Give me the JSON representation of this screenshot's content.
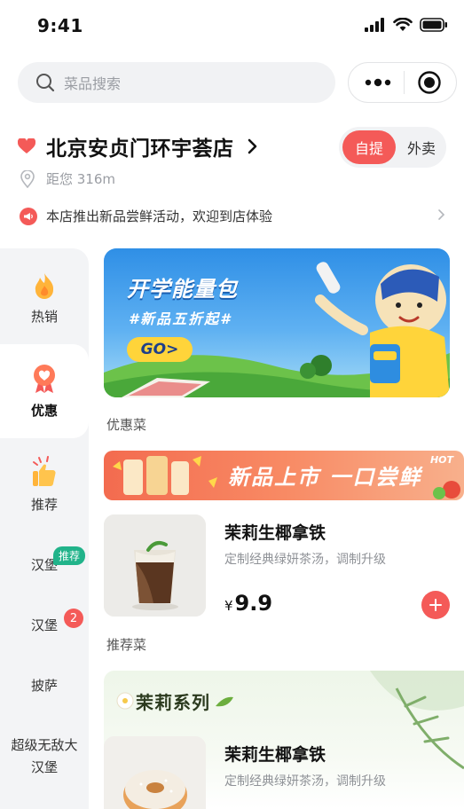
{
  "status": {
    "time": "9:41"
  },
  "search": {
    "placeholder": "菜品搜索"
  },
  "store": {
    "name": "北京安贞门环宇荟店",
    "distance": "距您 316m",
    "mode_pickup": "自提",
    "mode_delivery": "外卖",
    "notice": "本店推出新品尝鲜活动，欢迎到店体验"
  },
  "sidebar": {
    "items": [
      {
        "label": "热销",
        "icon": "fire-icon"
      },
      {
        "label": "优惠",
        "icon": "discount-heart-icon",
        "active": true
      },
      {
        "label": "推荐",
        "icon": "thumbs-up-icon"
      },
      {
        "label": "汉堡",
        "tag": "推荐"
      },
      {
        "label": "汉堡",
        "badge": "2"
      },
      {
        "label": "披萨"
      },
      {
        "label": "超级无敌大汉堡"
      }
    ]
  },
  "banner": {
    "title": "开学能量包",
    "subtitle": "#新品五折起#",
    "cta": "GO>"
  },
  "sections": {
    "discount": "优惠菜",
    "recommend": "推荐菜"
  },
  "promo": {
    "text": "新品上市 一口尝鲜",
    "hot": "HOT"
  },
  "products": [
    {
      "name": "茉莉生椰拿铁",
      "desc": "定制经典绿妍茶汤，调制升级",
      "currency": "¥",
      "price": "9.9"
    },
    {
      "name": "茉莉生椰拿铁",
      "desc": "定制经典绿妍茶汤，调制升级"
    }
  ],
  "series": {
    "title": "茉莉系列"
  },
  "colors": {
    "accent": "#f45a58",
    "tag_green": "#21b38a",
    "sidebar_bg": "#f3f4f6"
  }
}
